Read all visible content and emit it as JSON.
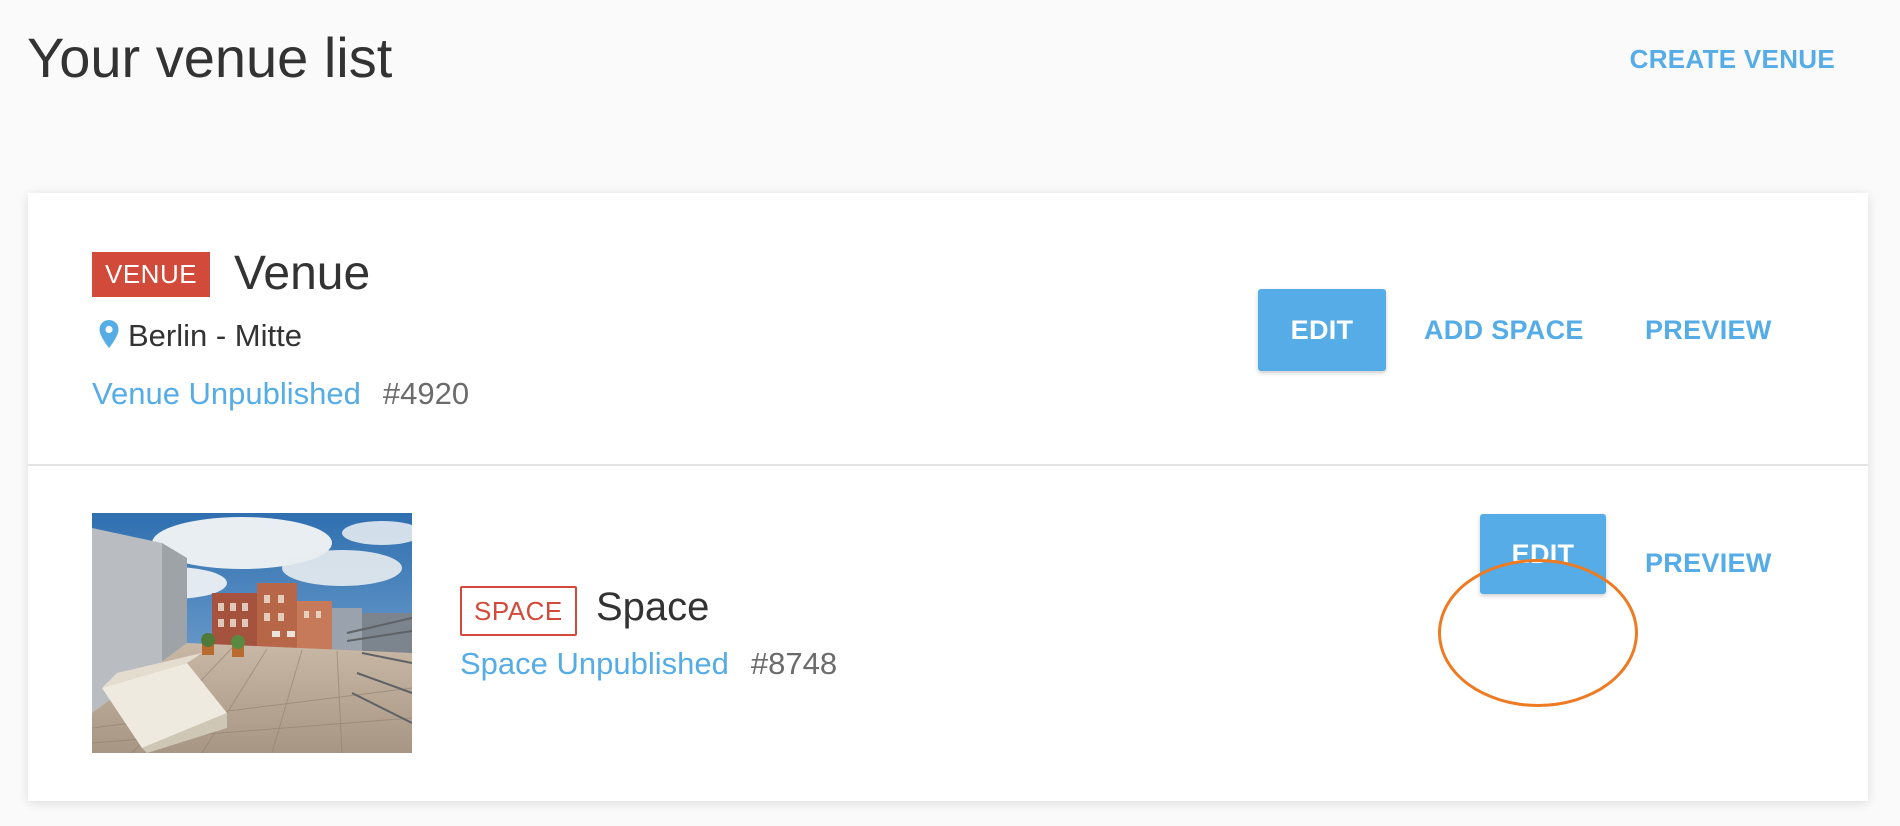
{
  "header": {
    "title": "Your venue list",
    "create_label": "CREATE VENUE"
  },
  "venue": {
    "badge": "VENUE",
    "name": "Venue",
    "location": "Berlin - Mitte",
    "status": "Venue Unpublished",
    "id": "#4920",
    "actions": {
      "edit": "EDIT",
      "add_space": "ADD SPACE",
      "preview": "PREVIEW"
    }
  },
  "space": {
    "badge": "SPACE",
    "name": "Space",
    "status": "Space Unpublished",
    "id": "#8748",
    "image_icon": "rooftop-terrace-photo",
    "actions": {
      "edit": "EDIT",
      "preview": "PREVIEW"
    }
  },
  "colors": {
    "accent": "#55ace6",
    "badge_red": "#d24a3a",
    "highlight": "#ee7a22",
    "text": "#333333",
    "muted": "#6b6b6b"
  },
  "icons": {
    "location": "map-pin-icon"
  }
}
